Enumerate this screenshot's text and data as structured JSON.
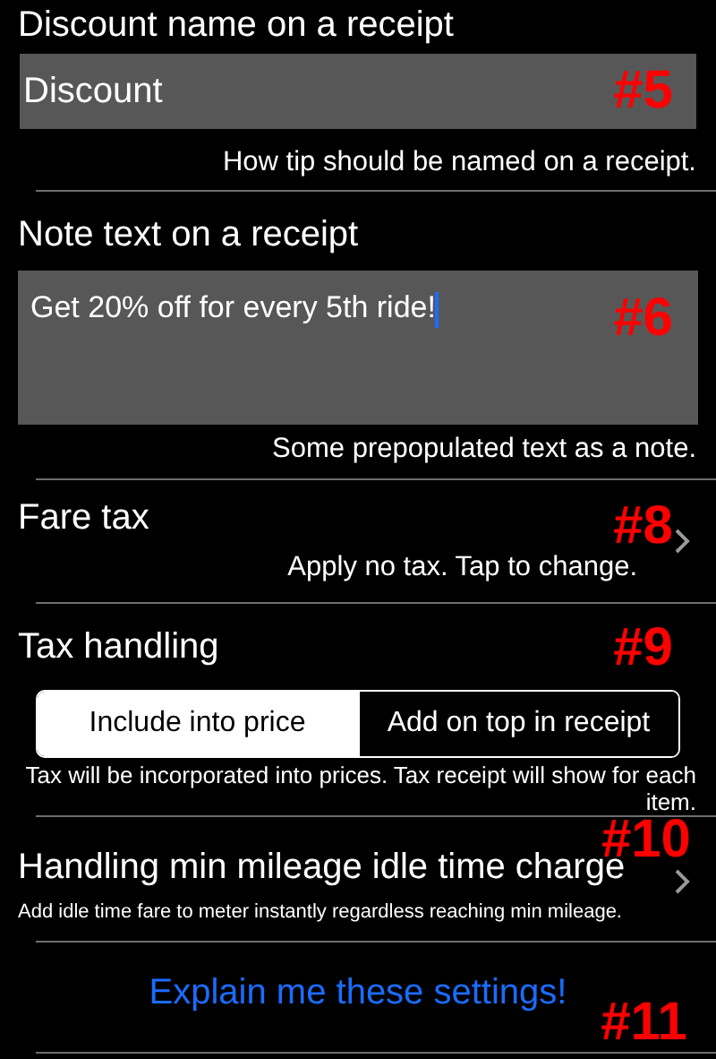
{
  "sections": [
    {
      "kind": "text_field",
      "title": "Discount name on a receipt",
      "value": "Discount",
      "hint": "How tip should be named on a receipt.",
      "annotation": "#5"
    },
    {
      "kind": "text_area",
      "title": "Note text on a receipt",
      "value": "Get 20% off for every 5th ride!",
      "hint": "Some prepopulated text as a note.",
      "annotation": "#6"
    },
    {
      "kind": "disclosure",
      "title": "Fare tax",
      "subtitle": "Apply no tax. Tap to change.",
      "annotation": "#8"
    },
    {
      "kind": "segmented",
      "title": "Tax handling",
      "options": [
        {
          "label": "Include into price",
          "selected": true
        },
        {
          "label": "Add on top in receipt",
          "selected": false
        }
      ],
      "hint": "Tax will be incorporated into prices. Tax receipt will show for each item.",
      "annotation": "#9"
    },
    {
      "kind": "disclosure_compact",
      "title": "Handling min mileage idle time charge",
      "subtitle": "Add idle time fare to meter instantly regardless reaching min mileage.",
      "annotation": "#10"
    },
    {
      "kind": "button",
      "label": "Explain me these settings!",
      "annotation": "#11"
    }
  ]
}
